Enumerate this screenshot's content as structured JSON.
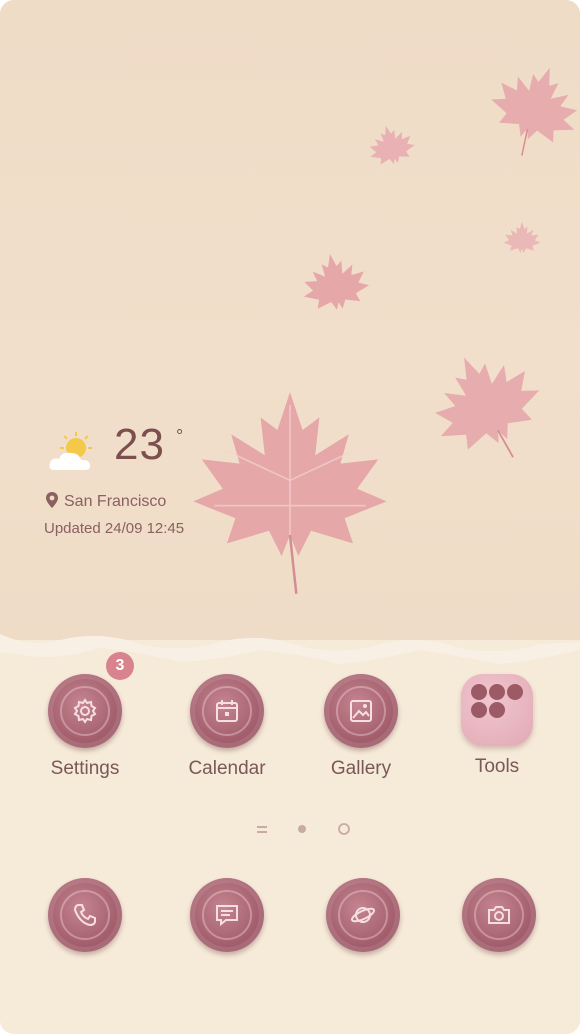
{
  "weather": {
    "temperature": "23",
    "degree_symbol": "°",
    "location": "San Francisco",
    "updated": "Updated 24/09 12:45"
  },
  "apps": [
    {
      "label": "Settings",
      "icon": "gear-icon",
      "badge": "3"
    },
    {
      "label": "Calendar",
      "icon": "calendar-icon"
    },
    {
      "label": "Gallery",
      "icon": "image-icon"
    },
    {
      "label": "Tools",
      "icon": "folder-grid-icon"
    }
  ],
  "dock": [
    {
      "icon": "phone-icon"
    },
    {
      "icon": "message-icon"
    },
    {
      "icon": "internet-icon"
    },
    {
      "icon": "camera-icon"
    }
  ],
  "page_indicator": {
    "pages": 3,
    "current": 2
  },
  "colors": {
    "paper": "#efdcc7",
    "leaf": "#e3a1a4",
    "coin": "#a45f6d",
    "text": "#7c4f4f",
    "badge": "#d8838d"
  }
}
